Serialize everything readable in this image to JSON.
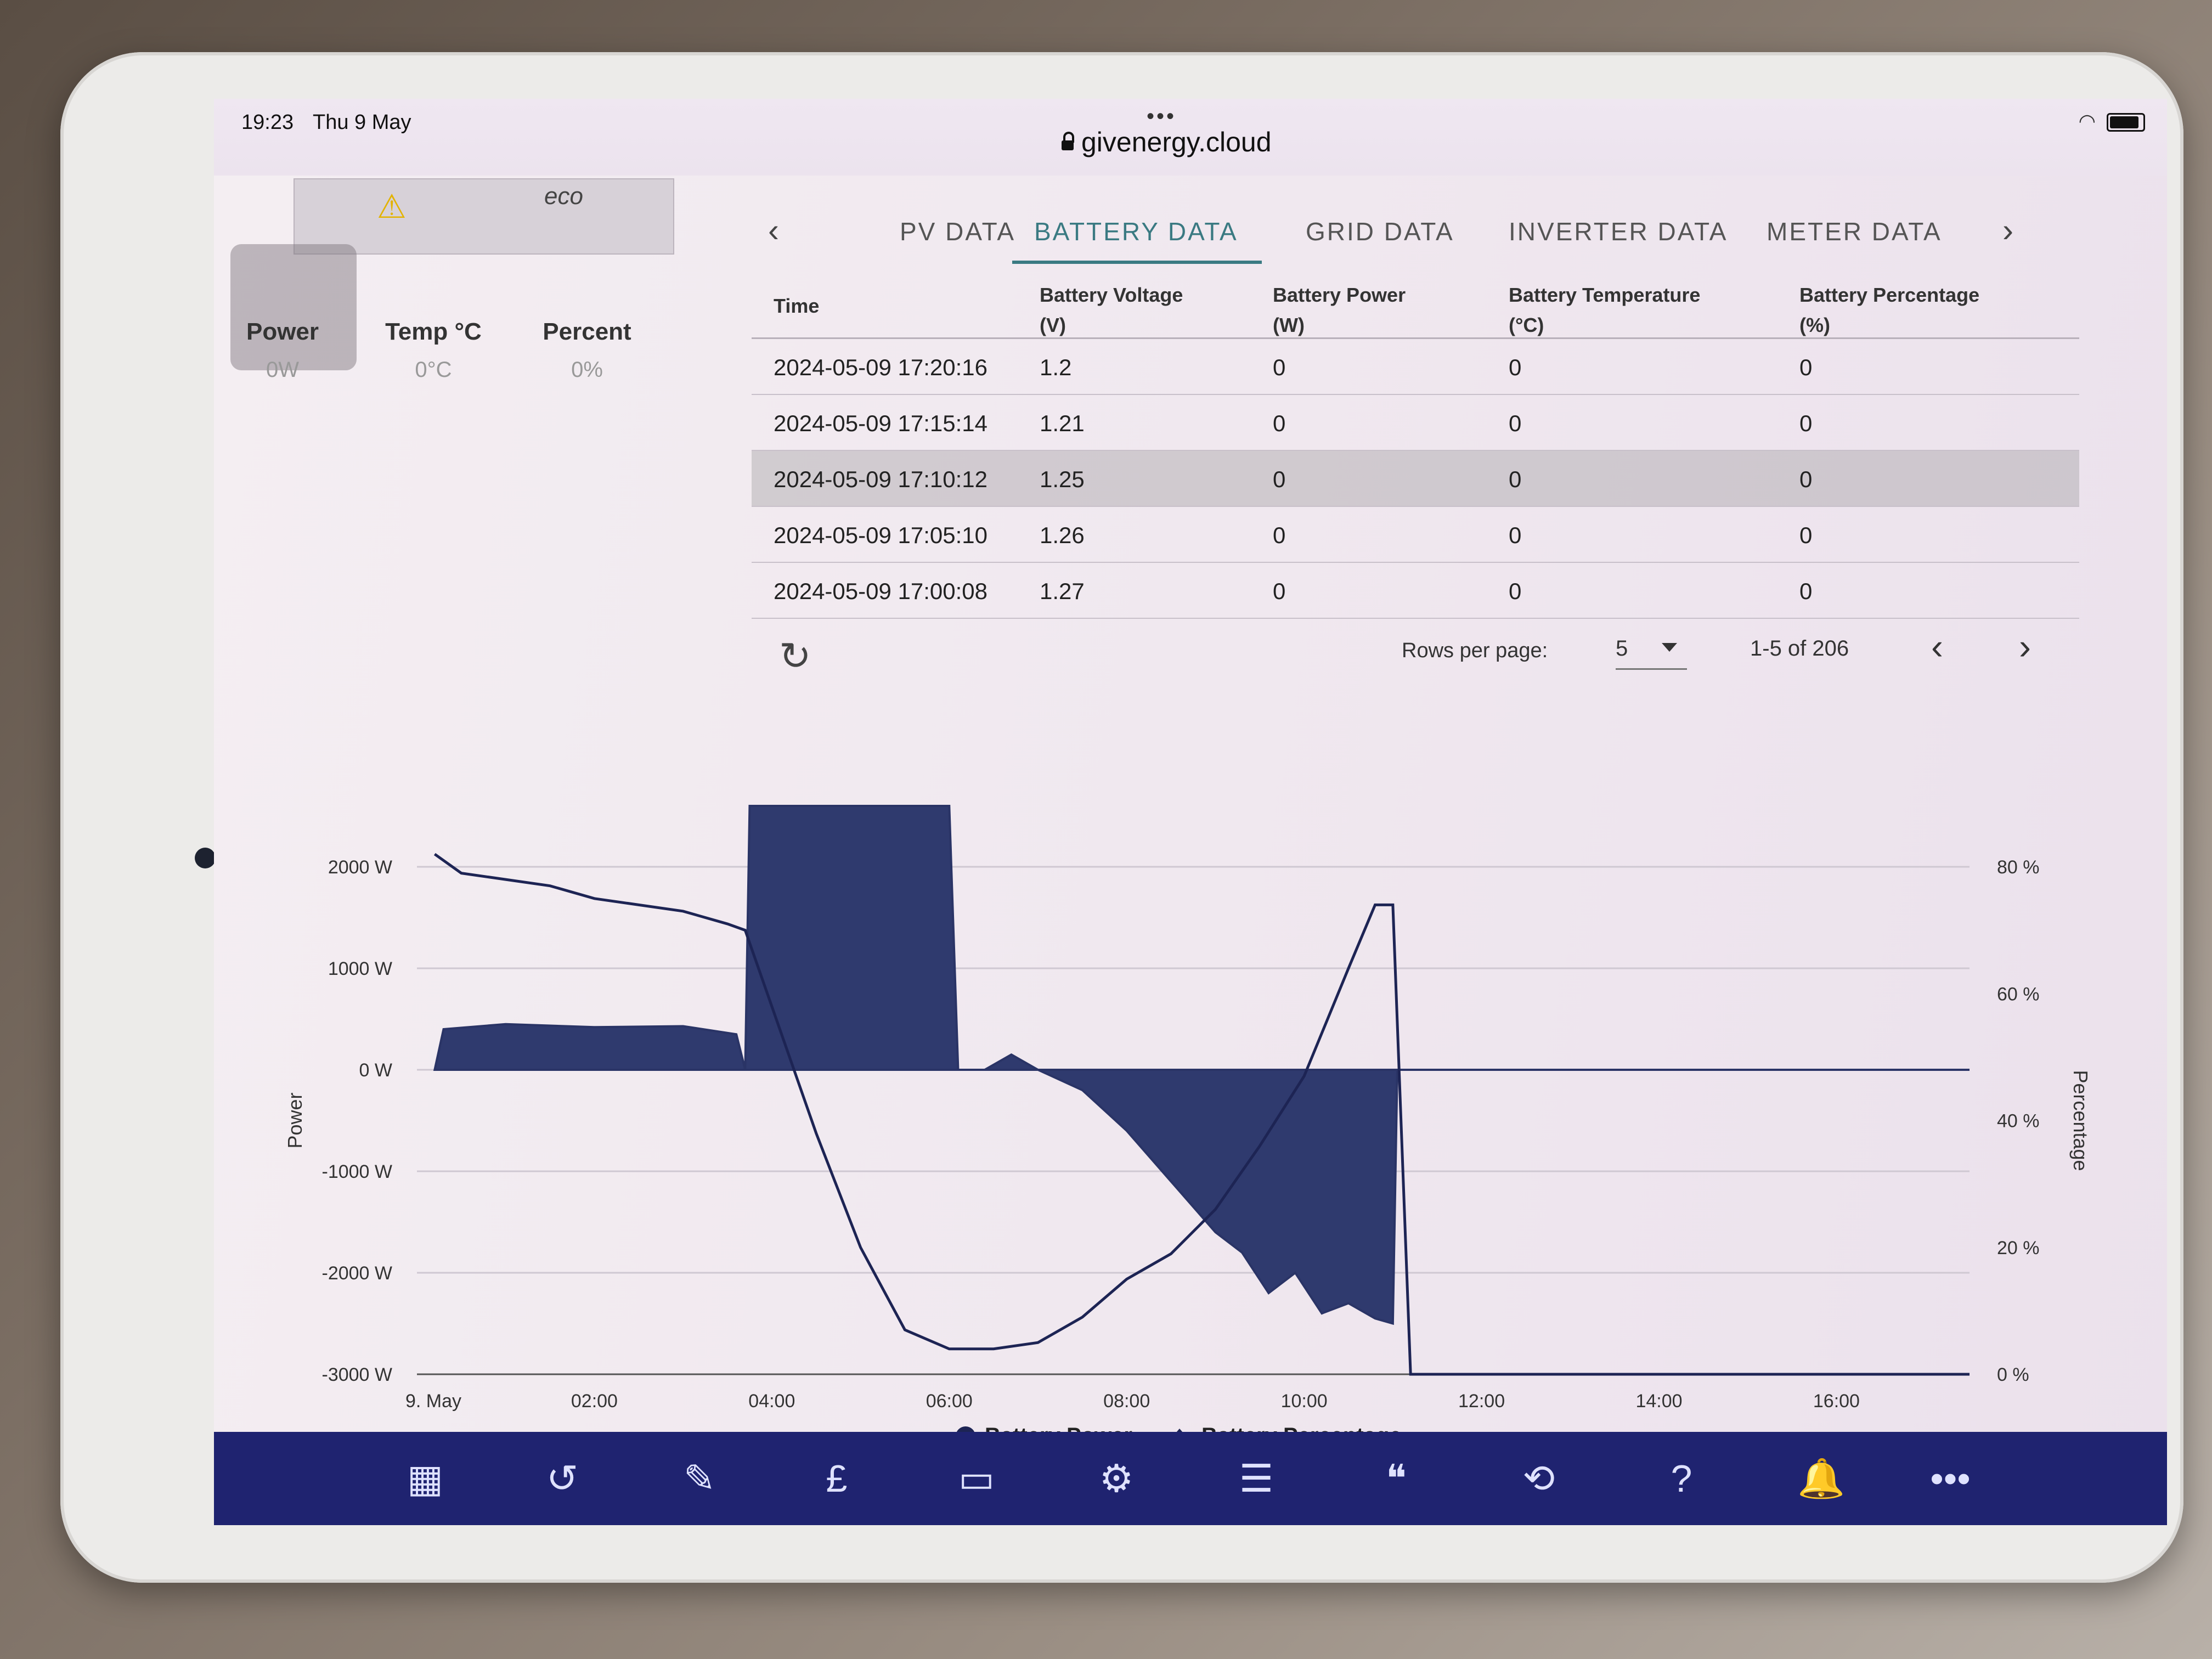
{
  "status": {
    "time": "19:23",
    "date": "Thu 9 May"
  },
  "browser": {
    "url": "givenergy.cloud"
  },
  "device": {
    "logo": "eco",
    "stats": [
      {
        "label": "Power",
        "value": "0W"
      },
      {
        "label": "Temp °C",
        "value": "0°C"
      },
      {
        "label": "Percent",
        "value": "0%"
      }
    ]
  },
  "tabs": {
    "items": [
      "PV DATA",
      "BATTERY DATA",
      "GRID DATA",
      "INVERTER DATA",
      "METER DATA"
    ],
    "active": "BATTERY DATA"
  },
  "table": {
    "headers": [
      [
        "Time"
      ],
      [
        "Battery Voltage",
        "(V)"
      ],
      [
        "Battery Power",
        "(W)"
      ],
      [
        "Battery Temperature",
        "(°C)"
      ],
      [
        "Battery Percentage",
        "(%)"
      ]
    ],
    "rows": [
      [
        "2024-05-09 17:20:16",
        "1.2",
        "0",
        "0",
        "0"
      ],
      [
        "2024-05-09 17:15:14",
        "1.21",
        "0",
        "0",
        "0"
      ],
      [
        "2024-05-09 17:10:12",
        "1.25",
        "0",
        "0",
        "0"
      ],
      [
        "2024-05-09 17:05:10",
        "1.26",
        "0",
        "0",
        "0"
      ],
      [
        "2024-05-09 17:00:08",
        "1.27",
        "0",
        "0",
        "0"
      ]
    ],
    "highlighted_row": 2
  },
  "pagination": {
    "rows_per_page_label": "Rows per page:",
    "rows_per_page": "5",
    "range": "1-5 of 206"
  },
  "chart_data": {
    "type": "area",
    "xlabel": "",
    "ylabel": "Power",
    "y2label": "Percentage",
    "x_ticks": [
      "9. May",
      "02:00",
      "04:00",
      "06:00",
      "08:00",
      "10:00",
      "12:00",
      "14:00",
      "16:00"
    ],
    "y_ticks": [
      "2000 W",
      "1000 W",
      "0 W",
      "-1000 W",
      "-2000 W",
      "-3000 W"
    ],
    "y2_ticks": [
      "80 %",
      "60 %",
      "40 %",
      "20 %",
      "0 %"
    ],
    "ylim": [
      -3000,
      2000
    ],
    "y2lim": [
      0,
      80
    ],
    "legend": [
      "Battery Power",
      "Battery Percentage"
    ],
    "legend_position": "bottom-center",
    "grid": true,
    "series": [
      {
        "name": "Battery Power",
        "x": [
          0.2,
          0.3,
          1.0,
          2.0,
          3.0,
          3.6,
          3.7,
          3.75,
          6.0,
          6.1,
          6.4,
          6.7,
          7.0,
          7.5,
          8.0,
          8.5,
          9.0,
          9.3,
          9.6,
          9.9,
          10.2,
          10.5,
          10.8,
          11.0,
          11.05,
          17.5
        ],
        "y": [
          0,
          400,
          450,
          420,
          430,
          350,
          0,
          2600,
          2600,
          0,
          0,
          150,
          0,
          -200,
          -600,
          -1100,
          -1600,
          -1800,
          -2200,
          -2000,
          -2400,
          -2300,
          -2450,
          -2500,
          0,
          0
        ]
      },
      {
        "name": "Battery Percentage",
        "x": [
          0.2,
          0.5,
          1.0,
          1.5,
          2.0,
          2.5,
          3.0,
          3.5,
          3.7,
          4.0,
          4.5,
          5.0,
          5.5,
          6.0,
          6.5,
          7.0,
          7.5,
          8.0,
          8.5,
          9.0,
          9.5,
          10.0,
          10.5,
          10.8,
          11.0,
          11.2,
          17.5
        ],
        "y": [
          82,
          79,
          78,
          77,
          75,
          74,
          73,
          71,
          70,
          58,
          38,
          20,
          7,
          4,
          4,
          5,
          9,
          15,
          19,
          26,
          36,
          47,
          64,
          74,
          74,
          0,
          0
        ]
      }
    ]
  },
  "bottom_nav": [
    {
      "name": "dashboard",
      "glyph": "▦"
    },
    {
      "name": "history",
      "glyph": "↺"
    },
    {
      "name": "edit",
      "glyph": "✎"
    },
    {
      "name": "pricing",
      "glyph": "£"
    },
    {
      "name": "monitor",
      "glyph": "▭"
    },
    {
      "name": "user-settings",
      "glyph": "⚙"
    },
    {
      "name": "messages",
      "glyph": "☰"
    },
    {
      "name": "quotes",
      "glyph": "❝"
    },
    {
      "name": "sync",
      "glyph": "⟲"
    },
    {
      "name": "help",
      "glyph": "?"
    },
    {
      "name": "notifications",
      "glyph": "🔔"
    },
    {
      "name": "more",
      "glyph": "•••"
    }
  ]
}
